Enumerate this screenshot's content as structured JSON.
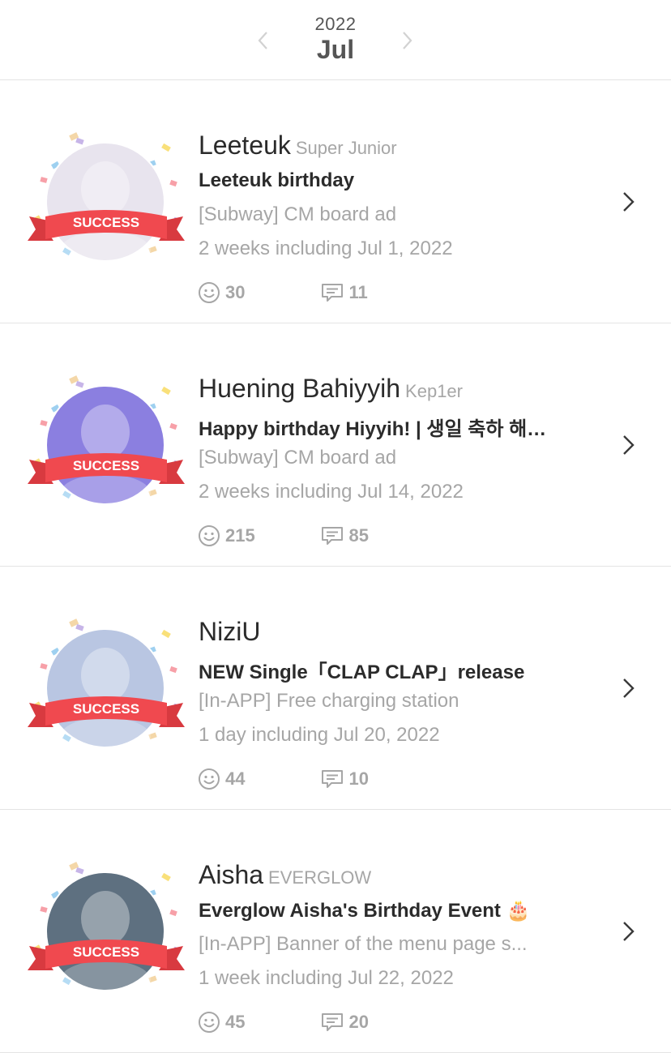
{
  "header": {
    "year": "2022",
    "month": "Jul",
    "prev_icon": "chevron-left-icon",
    "next_icon": "chevron-right-icon"
  },
  "events": [
    {
      "name": "Leeteuk",
      "group": "Super Junior",
      "title": "Leeteuk birthday",
      "ad": "[Subway] CM board ad",
      "period": "2 weeks including Jul 1, 2022",
      "likes": "30",
      "comments": "11",
      "badge": "SUCCESS",
      "photo_color": "#e8e4ee"
    },
    {
      "name": "Huening Bahiyyih",
      "group": "Kep1er",
      "title": "Happy birthday Hiyyih! | 생일 축하 해…",
      "ad": "[Subway] CM board ad",
      "period": "2 weeks including Jul 14, 2022",
      "likes": "215",
      "comments": "85",
      "badge": "SUCCESS",
      "photo_color": "#8b7fe0"
    },
    {
      "name": "NiziU",
      "group": "",
      "title": "NEW Single「CLAP CLAP」release",
      "ad": "[In-APP] Free charging station",
      "period": "1 day including Jul 20, 2022",
      "likes": "44",
      "comments": "10",
      "badge": "SUCCESS",
      "photo_color": "#b9c6e2"
    },
    {
      "name": "Aisha",
      "group": "EVERGLOW",
      "title": "Everglow Aisha's Birthday Event 🎂",
      "ad": "[In-APP] Banner of the menu page s...",
      "period": "1 week including Jul 22, 2022",
      "likes": "45",
      "comments": "20",
      "badge": "SUCCESS",
      "photo_color": "#5e7080"
    }
  ],
  "icons": {
    "likes": "smiley-icon",
    "comments": "comment-icon",
    "chevron": "chevron-right-icon"
  },
  "colors": {
    "ribbon": "#f0494f",
    "secondary_text": "#a6a6a6",
    "primary_text": "#2b2b2b"
  }
}
